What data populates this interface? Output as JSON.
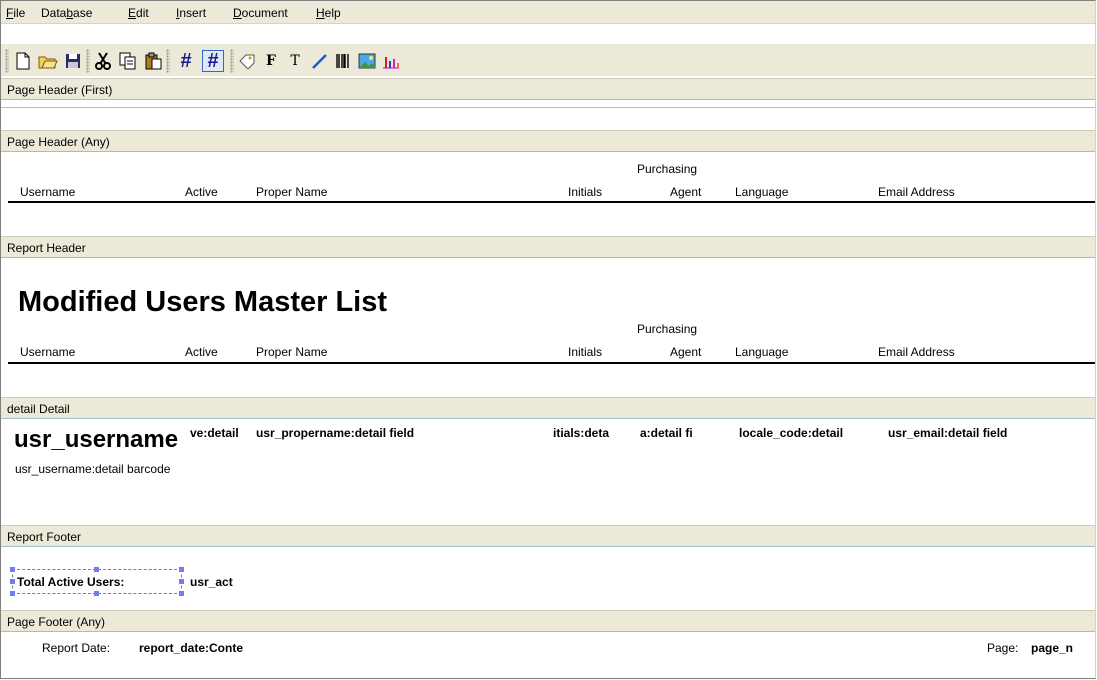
{
  "menu": [
    {
      "label": "File",
      "underline_index": 0
    },
    {
      "label": "Database",
      "underline_index": 4
    },
    {
      "label": "Edit",
      "underline_index": 0
    },
    {
      "label": "Insert",
      "underline_index": 0
    },
    {
      "label": "Document",
      "underline_index": 0
    },
    {
      "label": "Help",
      "underline_index": 0
    }
  ],
  "toolbar": [
    {
      "icon": "new-document-icon"
    },
    {
      "icon": "open-folder-icon"
    },
    {
      "icon": "save-disk-icon"
    },
    {
      "icon": "cut-scissors-icon"
    },
    {
      "icon": "copy-icon"
    },
    {
      "icon": "paste-icon"
    },
    {
      "icon": "grid-icon"
    },
    {
      "icon": "snap-to-grid-icon",
      "pressed": true
    },
    {
      "icon": "label-tag-icon"
    },
    {
      "icon": "field-icon"
    },
    {
      "icon": "text-icon"
    },
    {
      "icon": "line-icon"
    },
    {
      "icon": "barcode-icon"
    },
    {
      "icon": "image-icon"
    },
    {
      "icon": "chart-icon"
    }
  ],
  "bands": {
    "page_header_first": "Page Header (First)",
    "page_header_any": "Page Header (Any)",
    "report_header": "Report Header",
    "detail": "detail Detail",
    "report_footer": "Report Footer",
    "page_footer_any": "Page Footer (Any)"
  },
  "columns": {
    "username": "Username",
    "active": "Active",
    "proper_name": "Proper Name",
    "initials": "Initials",
    "purchasing": "Purchasing",
    "agent": "Agent",
    "language": "Language",
    "email": "Email Address"
  },
  "report_title": "Modified Users Master List",
  "detail_fields": {
    "username_big": "usr_username",
    "active": "ve:detail",
    "propername": "usr_propername:detail field",
    "initials": "itials:deta",
    "agent": "a:detail fi",
    "locale": "locale_code:detail",
    "email": "usr_email:detail field",
    "barcode": "usr_username:detail barcode"
  },
  "footer": {
    "total_label": "Total Active Users:",
    "total_field": "usr_act"
  },
  "page_footer": {
    "date_label": "Report Date:",
    "date_field": "report_date:Conte",
    "page_label": "Page:",
    "page_field": "page_n"
  },
  "colors": {
    "chrome": "#ece9d8",
    "band_border": "#a5bad4",
    "selection": "#6f7ff0"
  }
}
